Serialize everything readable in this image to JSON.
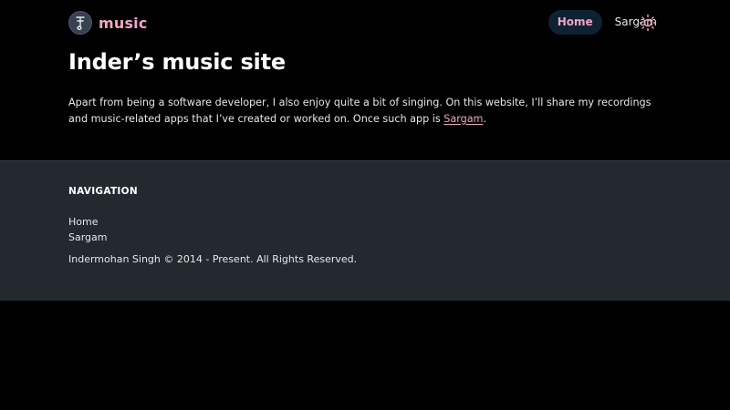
{
  "header": {
    "logo_icon": "music-note-logo-icon",
    "brand_name": "music",
    "nav": [
      {
        "label": "Home",
        "active": true
      },
      {
        "label": "Sargam",
        "active": false
      }
    ],
    "theme_toggle_icon": "sun-icon"
  },
  "main": {
    "title": "Inder’s music site",
    "intro_text": "Apart from being a software developer, I also enjoy quite a bit of singing. On this website, I’ll share my recordings and music-related apps that I’ve created or worked on. Once such app is ",
    "intro_link": "Sargam",
    "intro_end": "."
  },
  "footer": {
    "heading": "NAVIGATION",
    "links": [
      "Home",
      "Sargam"
    ],
    "copyright": "Indermohan Singh © 2014 - Present. All Rights Reserved."
  },
  "colors": {
    "background": "#000000",
    "accent": "#f0a5c4",
    "footer_bg": "#24292f",
    "active_nav_bg": "#0f2233"
  }
}
